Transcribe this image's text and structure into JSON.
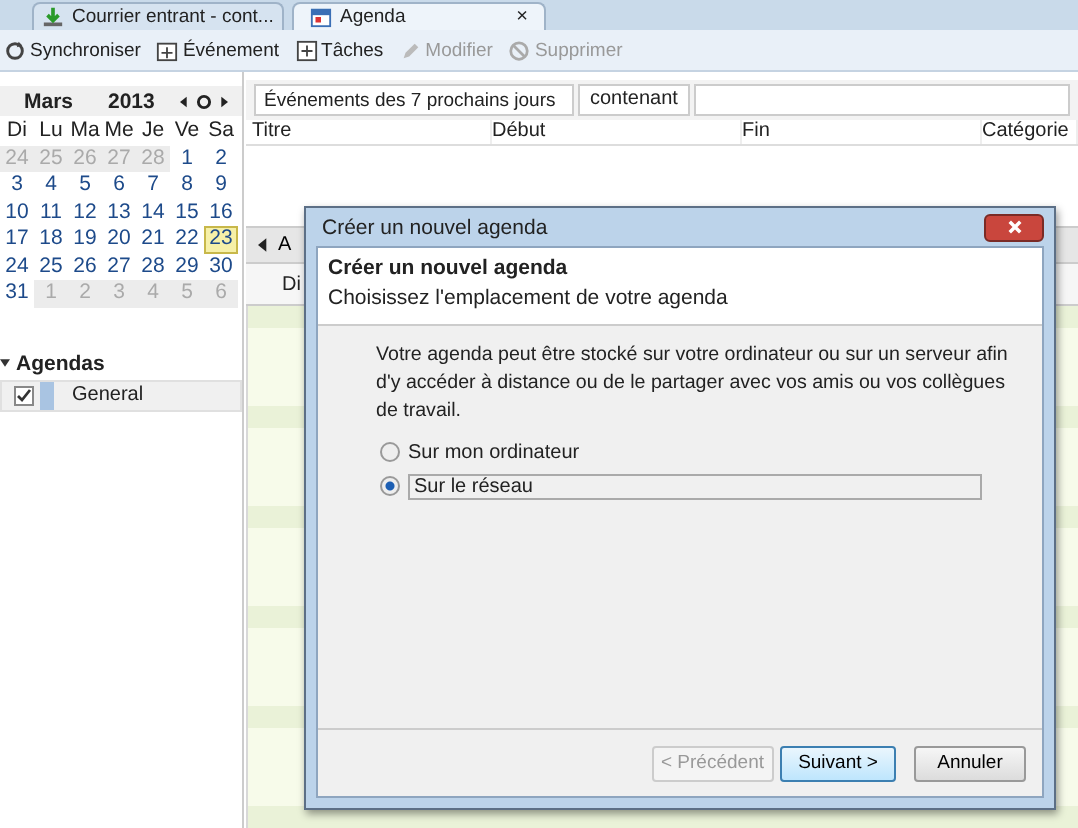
{
  "tabs": [
    {
      "label": "Courrier entrant - cont...",
      "selected": false
    },
    {
      "label": "Agenda",
      "selected": true,
      "close": "×"
    }
  ],
  "toolbar": [
    {
      "label": "Synchroniser",
      "disabled": false
    },
    {
      "label": "Événement",
      "disabled": false
    },
    {
      "label": "Tâches",
      "disabled": false
    },
    {
      "label": "Modifier",
      "disabled": true
    },
    {
      "label": "Supprimer",
      "disabled": true
    }
  ],
  "minicalendar": {
    "month": "Mars",
    "year": "2013",
    "weekdays": [
      "Di",
      "Lu",
      "Ma",
      "Me",
      "Je",
      "Ve",
      "Sa"
    ],
    "weeks": [
      [
        {
          "day": "24",
          "other_month": true,
          "selected": false
        },
        {
          "day": "25",
          "other_month": true,
          "selected": false
        },
        {
          "day": "26",
          "other_month": true,
          "selected": false
        },
        {
          "day": "27",
          "other_month": true,
          "selected": false
        },
        {
          "day": "28",
          "other_month": true,
          "selected": false
        },
        {
          "day": "1",
          "other_month": false,
          "selected": false
        },
        {
          "day": "2",
          "other_month": false,
          "selected": false
        }
      ],
      [
        {
          "day": "3",
          "other_month": false,
          "selected": false
        },
        {
          "day": "4",
          "other_month": false,
          "selected": false
        },
        {
          "day": "5",
          "other_month": false,
          "selected": false
        },
        {
          "day": "6",
          "other_month": false,
          "selected": false
        },
        {
          "day": "7",
          "other_month": false,
          "selected": false
        },
        {
          "day": "8",
          "other_month": false,
          "selected": false
        },
        {
          "day": "9",
          "other_month": false,
          "selected": false
        }
      ],
      [
        {
          "day": "10",
          "other_month": false,
          "selected": false
        },
        {
          "day": "11",
          "other_month": false,
          "selected": false
        },
        {
          "day": "12",
          "other_month": false,
          "selected": false
        },
        {
          "day": "13",
          "other_month": false,
          "selected": false
        },
        {
          "day": "14",
          "other_month": false,
          "selected": false
        },
        {
          "day": "15",
          "other_month": false,
          "selected": false
        },
        {
          "day": "16",
          "other_month": false,
          "selected": false
        }
      ],
      [
        {
          "day": "17",
          "other_month": false,
          "selected": false
        },
        {
          "day": "18",
          "other_month": false,
          "selected": false
        },
        {
          "day": "19",
          "other_month": false,
          "selected": false
        },
        {
          "day": "20",
          "other_month": false,
          "selected": false
        },
        {
          "day": "21",
          "other_month": false,
          "selected": false
        },
        {
          "day": "22",
          "other_month": false,
          "selected": false
        },
        {
          "day": "23",
          "other_month": false,
          "selected": true
        }
      ],
      [
        {
          "day": "24",
          "other_month": false,
          "selected": false
        },
        {
          "day": "25",
          "other_month": false,
          "selected": false
        },
        {
          "day": "26",
          "other_month": false,
          "selected": false
        },
        {
          "day": "27",
          "other_month": false,
          "selected": false
        },
        {
          "day": "28",
          "other_month": false,
          "selected": false
        },
        {
          "day": "29",
          "other_month": false,
          "selected": false
        },
        {
          "day": "30",
          "other_month": false,
          "selected": false
        }
      ],
      [
        {
          "day": "31",
          "other_month": false,
          "selected": false
        },
        {
          "day": "1",
          "other_month": true,
          "selected": false
        },
        {
          "day": "2",
          "other_month": true,
          "selected": false
        },
        {
          "day": "3",
          "other_month": true,
          "selected": false
        },
        {
          "day": "4",
          "other_month": true,
          "selected": false
        },
        {
          "day": "5",
          "other_month": true,
          "selected": false
        },
        {
          "day": "6",
          "other_month": true,
          "selected": false
        }
      ]
    ]
  },
  "agendas": {
    "heading": "Agendas",
    "expanded": true,
    "items": [
      {
        "name": "General",
        "checked": true,
        "color": "#a9c4e2"
      }
    ]
  },
  "filter": {
    "dropdown": "Événements des 7 prochains jours",
    "label": "contenant"
  },
  "event_list": {
    "columns": [
      "Titre",
      "Début",
      "Fin",
      "Catégorie"
    ]
  },
  "week_view": {
    "nav_label": "A",
    "day_header": "Di"
  },
  "dialog": {
    "title": "Créer un nouvel agenda",
    "heading": "Créer un nouvel agenda",
    "subheading": "Choisissez l'emplacement de votre agenda",
    "description": "Votre agenda peut être stocké sur votre ordinateur ou sur un serveur afin d'y accéder à distance ou de le partager avec vos amis ou vos collègues de travail.",
    "options": [
      {
        "label": "Sur mon ordinateur",
        "selected": false
      },
      {
        "label": "Sur le réseau",
        "selected": true
      }
    ],
    "buttons": [
      {
        "label": "< Précédent",
        "disabled": true,
        "default": false
      },
      {
        "label": "Suivant >",
        "disabled": false,
        "default": true
      },
      {
        "label": "Annuler",
        "disabled": false,
        "default": false
      }
    ]
  }
}
